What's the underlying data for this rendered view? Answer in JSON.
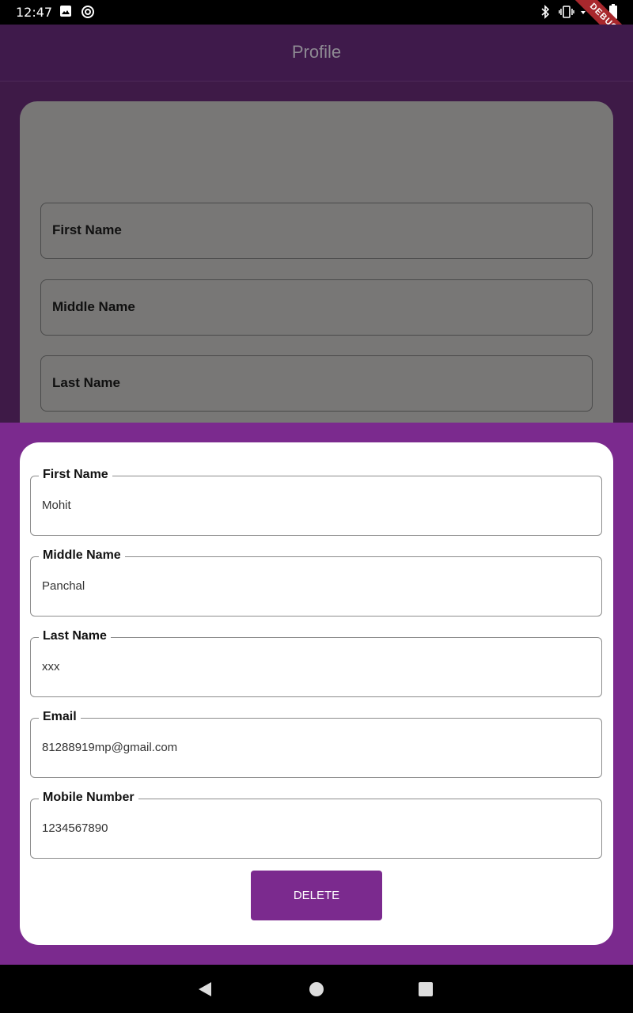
{
  "status_bar": {
    "time": "12:47",
    "debug_label": "DEBUG",
    "icons": [
      "image-icon",
      "sync-icon",
      "bluetooth-icon",
      "vibrate-icon",
      "wifi-icon",
      "battery-icon"
    ]
  },
  "app_bar": {
    "title": "Profile"
  },
  "background_form": {
    "fields": [
      {
        "label": "First Name"
      },
      {
        "label": "Middle Name"
      },
      {
        "label": "Last Name"
      }
    ]
  },
  "sheet": {
    "fields": [
      {
        "label": "First Name",
        "value": "Mohit"
      },
      {
        "label": "Middle Name",
        "value": "Panchal"
      },
      {
        "label": "Last Name",
        "value": "xxx"
      },
      {
        "label": "Email",
        "value": "81288919mp@gmail.com"
      },
      {
        "label": "Mobile Number",
        "value": "1234567890"
      }
    ],
    "delete_label": "DELETE"
  },
  "nav_bar": {
    "icons": [
      "back-icon",
      "home-icon",
      "recents-icon"
    ]
  },
  "colors": {
    "primary": "#7b2a8e",
    "app_bar": "#3f1a4b",
    "scrim_card": "#787776"
  }
}
